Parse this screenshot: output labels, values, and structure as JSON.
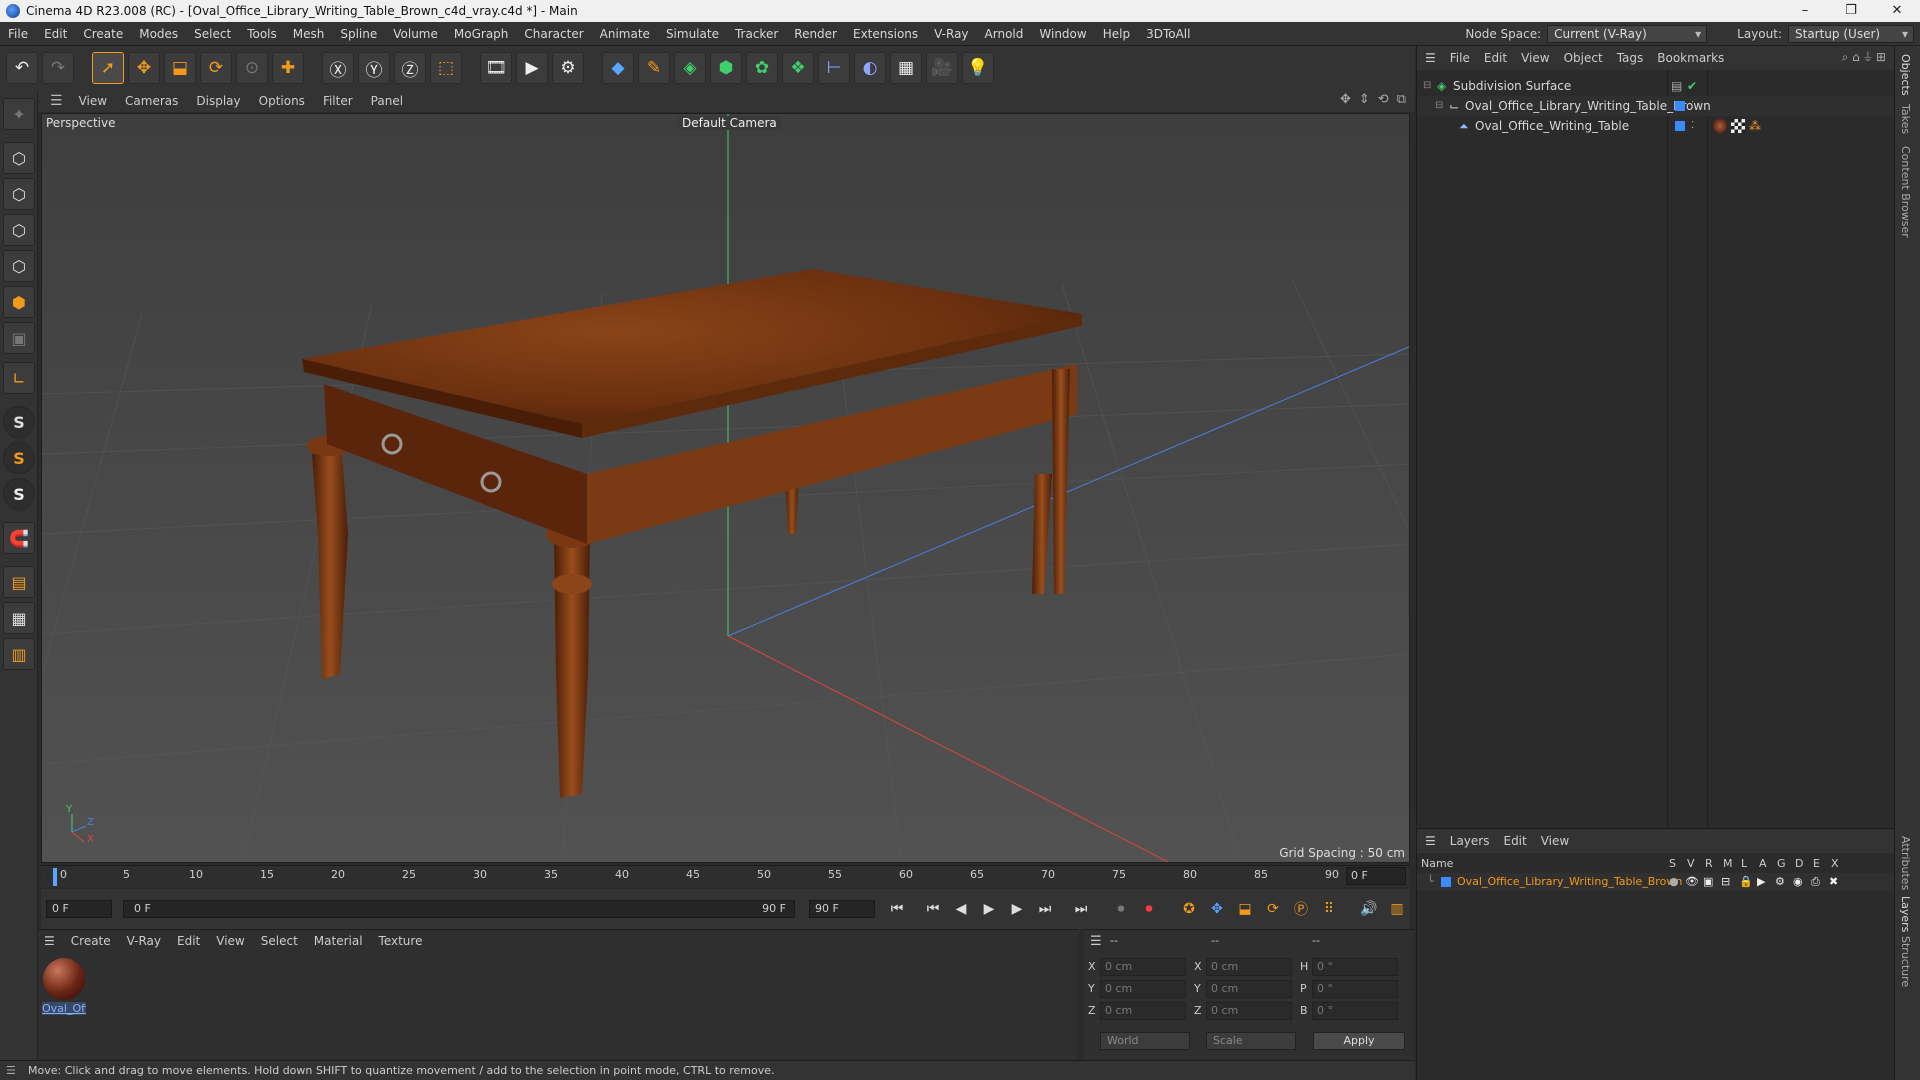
{
  "window": {
    "title": "Cinema 4D R23.008 (RC) - [Oval_Office_Library_Writing_Table_Brown_c4d_vray.c4d *] - Main",
    "controls": [
      "–",
      "❐",
      "✕"
    ]
  },
  "menubar": {
    "items": [
      "File",
      "Edit",
      "Create",
      "Modes",
      "Select",
      "Tools",
      "Mesh",
      "Spline",
      "Volume",
      "MoGraph",
      "Character",
      "Animate",
      "Simulate",
      "Tracker",
      "Render",
      "Extensions",
      "V-Ray",
      "Arnold",
      "Window",
      "Help",
      "3DToAll"
    ],
    "node_space_label": "Node Space:",
    "node_space_value": "Current (V-Ray)",
    "layout_label": "Layout:",
    "layout_value": "Startup (User)"
  },
  "toolbar": {
    "icons": [
      "undo-icon",
      "redo-icon",
      "select-icon",
      "move-icon",
      "scale-icon",
      "rotate-icon",
      "live-select-icon",
      "add-icon",
      "x-axis-icon",
      "y-axis-icon",
      "z-axis-icon",
      "coordinate-system-icon",
      "render-region-icon",
      "render-view-icon",
      "render-settings-icon",
      "cube-icon",
      "pen-icon",
      "subdivision-icon",
      "extrude-icon",
      "cloner-icon",
      "mograph-icon",
      "measure-icon",
      "deformer-icon",
      "floor-icon",
      "camera-icon",
      "light-icon"
    ]
  },
  "lefttools": {
    "icons": [
      "model-mode-icon",
      "texture-mode-icon",
      "points-mode-icon",
      "edges-mode-icon",
      "polygons-mode-icon",
      "uv-mode-icon",
      "axis-icon",
      "snap-icon",
      "snap-settings-icon",
      "snap-sync-icon",
      "magnet-icon",
      "workplane-icon",
      "grid-icon",
      "locked-workplane-icon"
    ]
  },
  "viewport": {
    "menu": [
      "View",
      "Cameras",
      "Display",
      "Options",
      "Filter",
      "Panel"
    ],
    "projection": "Perspective",
    "camera": "Default Camera",
    "grid_spacing": "Grid Spacing : 50 cm",
    "axis_labels": {
      "y": "Y",
      "z": "Z",
      "x": "X"
    }
  },
  "timeline": {
    "ticks": [
      "0",
      "5",
      "10",
      "15",
      "20",
      "25",
      "30",
      "35",
      "40",
      "45",
      "50",
      "55",
      "60",
      "65",
      "70",
      "75",
      "80",
      "85",
      "90"
    ],
    "current_frame": "0 F"
  },
  "transport": {
    "start_field": "0 F",
    "range_start": "0 F",
    "range_end": "90 F",
    "end_field": "90 F"
  },
  "materials": {
    "menu": [
      "Create",
      "V-Ray",
      "Edit",
      "View",
      "Select",
      "Material",
      "Texture"
    ],
    "items": [
      {
        "label": "Oval_Off"
      }
    ]
  },
  "coordinates": {
    "headers": [
      "--",
      "--",
      "--"
    ],
    "rows": [
      {
        "axis": "X",
        "pos": "0 cm",
        "axis2": "X",
        "size": "0 cm",
        "rot_label": "H",
        "rot": "0 °"
      },
      {
        "axis": "Y",
        "pos": "0 cm",
        "axis2": "Y",
        "size": "0 cm",
        "rot_label": "P",
        "rot": "0 °"
      },
      {
        "axis": "Z",
        "pos": "0 cm",
        "axis2": "Z",
        "size": "0 cm",
        "rot_label": "B",
        "rot": "0 °"
      }
    ],
    "space": "World",
    "mode": "Scale",
    "apply_label": "Apply"
  },
  "status": {
    "text": "Move: Click and drag to move elements. Hold down SHIFT to quantize movement / add to the selection in point mode, CTRL to remove."
  },
  "objects": {
    "menu": [
      "File",
      "Edit",
      "View",
      "Object",
      "Tags",
      "Bookmarks"
    ],
    "rows": [
      {
        "name": "Subdivision Surface"
      },
      {
        "name": "Oval_Office_Library_Writing_Table_Brown"
      },
      {
        "name": "Oval_Office_Writing_Table"
      }
    ]
  },
  "layers": {
    "menu": [
      "Layers",
      "Edit",
      "View"
    ],
    "name_header": "Name",
    "flag_headers": [
      "S",
      "V",
      "R",
      "M",
      "L",
      "A",
      "G",
      "D",
      "E",
      "X"
    ],
    "rows": [
      {
        "name": "Oval_Office_Library_Writing_Table_Brown"
      }
    ]
  },
  "side_tabs": [
    "Objects",
    "Takes",
    "Content Browser",
    "Attributes",
    "Layers",
    "Structure"
  ],
  "colors": {
    "accent": "#f29a1b",
    "layer_name": "#f29a1b",
    "x_axis": "#e0443a",
    "y_axis": "#3fcf6b",
    "z_axis": "#4a7fe0"
  }
}
